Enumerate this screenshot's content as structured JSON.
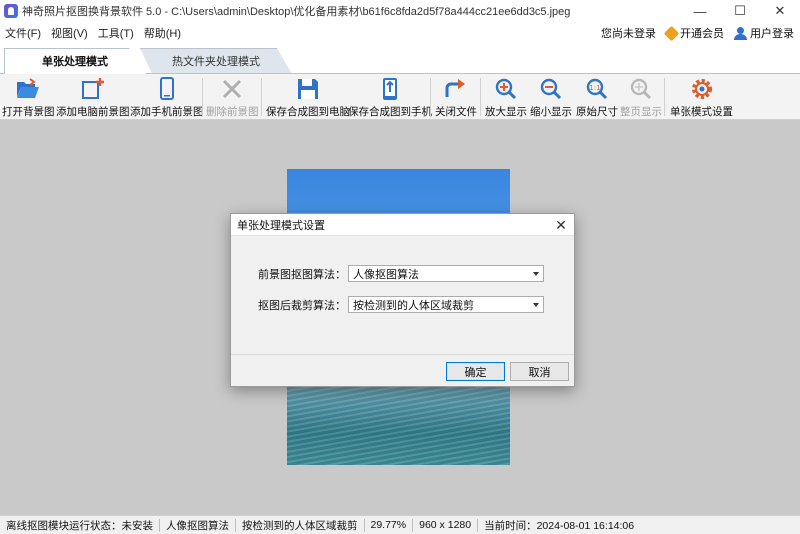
{
  "window": {
    "title": "神奇照片抠图换背景软件 5.0 - C:\\Users\\admin\\Desktop\\优化备用素材\\b61f6c8fda2d5f78a444cc21ee6dd3c5.jpeg",
    "controls": {
      "minimize": "—",
      "maximize": "☐",
      "close": "✕"
    }
  },
  "menu": {
    "items": [
      "文件(F)",
      "视图(V)",
      "工具(T)",
      "帮助(H)"
    ],
    "right": {
      "login_status": "您尚未登录",
      "vip": "开通会员",
      "user_login": "用户登录"
    }
  },
  "tabs": [
    {
      "label": "单张处理模式",
      "active": true
    },
    {
      "label": "热文件夹处理模式",
      "active": false
    }
  ],
  "toolbar": {
    "open_bg": "打开背景图",
    "add_pc_fg": "添加电脑前景图",
    "add_phone_fg": "添加手机前景图",
    "delete_fg": "删除前景图",
    "save_to_pc": "保存合成图到电脑",
    "save_to_phone": "保存合成图到手机",
    "close_file": "关闭文件",
    "zoom_in": "放大显示",
    "zoom_out": "缩小显示",
    "original_size": "原始尺寸",
    "fit_page": "整页显示",
    "settings": "单张模式设置"
  },
  "dialog": {
    "title": "单张处理模式设置",
    "close": "✕",
    "fg_algo_label": "前景图抠图算法：",
    "fg_algo_value": "人像抠图算法",
    "crop_algo_label": "抠图后裁剪算法：",
    "crop_algo_value": "按检测到的人体区域裁剪",
    "ok": "确定",
    "cancel": "取消"
  },
  "status": {
    "module_state": "离线抠图模块运行状态：未安装",
    "algorithm": "人像抠图算法",
    "crop": "按检测到的人体区域裁剪",
    "zoom": "29.77%",
    "dimensions": "960 x 1280",
    "time": "当前时间：2024-08-01 16:14:06"
  }
}
